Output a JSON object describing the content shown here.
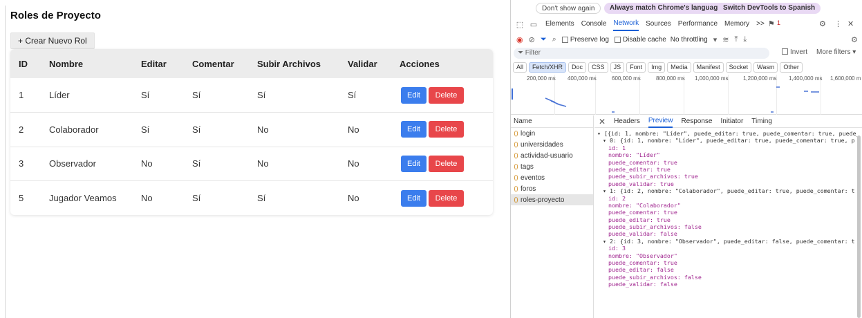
{
  "app": {
    "title": "Roles de Proyecto",
    "create_button": "+ Crear Nuevo Rol",
    "columns": [
      "ID",
      "Nombre",
      "Editar",
      "Comentar",
      "Subir Archivos",
      "Validar",
      "Acciones"
    ],
    "rows": [
      {
        "id": "1",
        "nombre": "Líder",
        "editar": "Sí",
        "comentar": "Sí",
        "subir": "Sí",
        "validar": "Sí"
      },
      {
        "id": "2",
        "nombre": "Colaborador",
        "editar": "Sí",
        "comentar": "Sí",
        "subir": "No",
        "validar": "No"
      },
      {
        "id": "3",
        "nombre": "Observador",
        "editar": "No",
        "comentar": "Sí",
        "subir": "No",
        "validar": "No"
      },
      {
        "id": "5",
        "nombre": "Jugador Veamos",
        "editar": "No",
        "comentar": "Sí",
        "subir": "Sí",
        "validar": "No"
      }
    ],
    "edit_label": "Edit",
    "delete_label": "Delete",
    "colors": {
      "edit": "#3b7ded",
      "delete": "#e8464a"
    }
  },
  "devtools": {
    "infobar": {
      "dont_show": "Don't show again",
      "always_match": "Always match Chrome's language",
      "switch_lang": "Switch DevTools to Spanish"
    },
    "tabs": [
      "Elements",
      "Console",
      "Network",
      "Sources",
      "Performance",
      "Memory"
    ],
    "more_tabs": ">>",
    "issues_badge": "1",
    "toolbar": {
      "preserve_log": "Preserve log",
      "disable_cache": "Disable cache",
      "throttling": "No throttling"
    },
    "filter_placeholder": "Filter",
    "invert": "Invert",
    "more_filters": "More filters ▾",
    "type_filters": [
      "All",
      "Fetch/XHR",
      "Doc",
      "CSS",
      "JS",
      "Font",
      "Img",
      "Media",
      "Manifest",
      "Socket",
      "Wasm",
      "Other"
    ],
    "timeline_ticks": [
      "200,000 ms",
      "400,000 ms",
      "600,000 ms",
      "800,000 ms",
      "1,000,000 ms",
      "1,200,000 ms",
      "1,400,000 ms",
      "1,600,000 m"
    ],
    "name_header": "Name",
    "requests": [
      "login",
      "universidades",
      "actividad-usuario",
      "tags",
      "eventos",
      "foros",
      "roles-proyecto"
    ],
    "detail_tabs": [
      "Headers",
      "Preview",
      "Response",
      "Initiator",
      "Timing"
    ],
    "preview_lines": [
      "▾ [{id: 1, nombre: \"Líder\", puede_editar: true, puede_comentar: true, puede_",
      "▾ 0: {id: 1, nombre: \"Líder\", puede_editar: true, puede_comentar: true, p",
      "id: 1",
      "nombre: \"Líder\"",
      "puede_comentar: true",
      "puede_editar: true",
      "puede_subir_archivos: true",
      "puede_validar: true",
      "▾ 1: {id: 2, nombre: \"Colaborador\", puede_editar: true, puede_comentar: t",
      "id: 2",
      "nombre: \"Colaborador\"",
      "puede_comentar: true",
      "puede_editar: true",
      "puede_subir_archivos: false",
      "puede_validar: false",
      "▾ 2: {id: 3, nombre: \"Observador\", puede_editar: false, puede_comentar: t",
      "id: 3",
      "nombre: \"Observador\"",
      "puede_comentar: true",
      "puede_editar: false",
      "puede_subir_archivos: false",
      "puede_validar: false"
    ]
  }
}
